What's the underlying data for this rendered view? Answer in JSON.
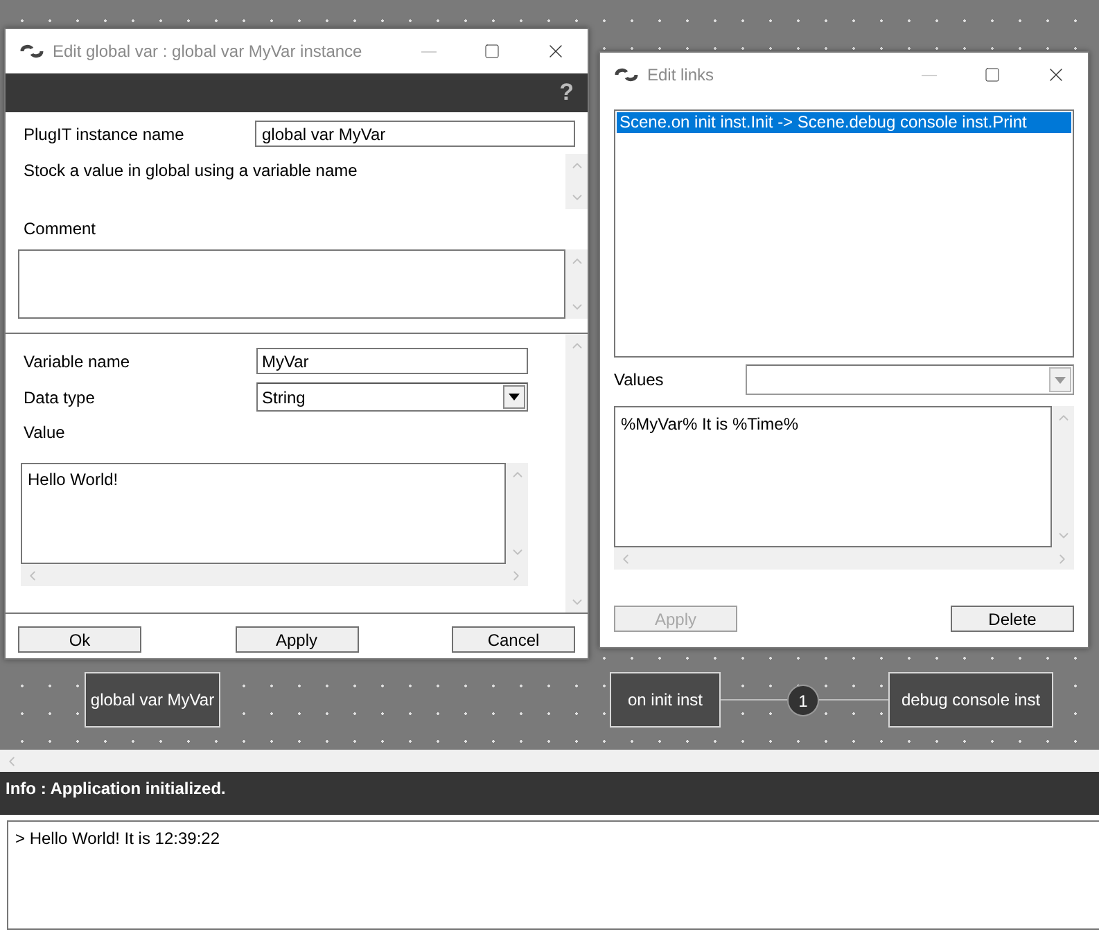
{
  "global_var_window": {
    "title": "Edit global var : global var MyVar instance",
    "help": "?",
    "instance_name_label": "PlugIT instance name",
    "instance_name": "global var MyVar",
    "description": "Stock a value in global using a variable name",
    "comment_label": "Comment",
    "variable_name_label": "Variable name",
    "variable_name": "MyVar",
    "data_type_label": "Data type",
    "data_type": "String",
    "value_label": "Value",
    "value": "Hello World!",
    "buttons": [
      {
        "label": "Ok",
        "disabled": false
      },
      {
        "label": "Apply",
        "disabled": false
      },
      {
        "label": "Cancel",
        "disabled": false
      }
    ]
  },
  "links_window": {
    "title": "Edit links",
    "links": [
      {
        "label": "Scene.on init inst.Init -> Scene.debug console inst.Print",
        "selected": true
      }
    ],
    "values_label": "Values",
    "message": "%MyVar% It is %Time%",
    "buttons": [
      {
        "label": "Apply",
        "disabled": true
      },
      {
        "label": "Delete",
        "disabled": false
      }
    ]
  },
  "canvas": {
    "nodes": [
      {
        "label": "global var MyVar"
      },
      {
        "label": "on init inst"
      },
      {
        "label": "debug console inst"
      }
    ],
    "link_badge": "1"
  },
  "info_bar": "Info : Application initialized.",
  "console": {
    "lines": [
      "> Hello World! It is 12:39:22"
    ]
  }
}
